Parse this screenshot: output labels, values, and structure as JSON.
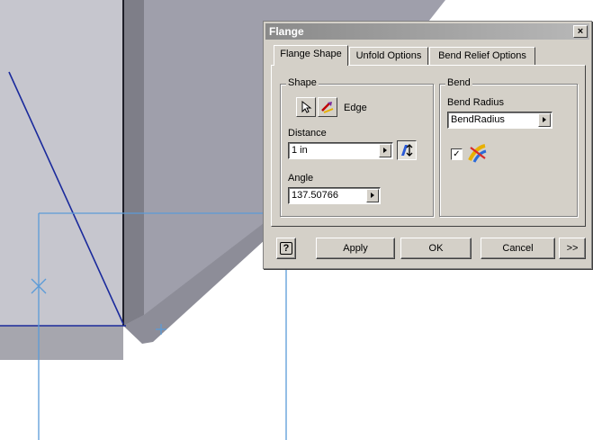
{
  "dialog": {
    "title": "Flange",
    "close_label": "×",
    "tabs": [
      {
        "label": "Flange Shape"
      },
      {
        "label": "Unfold Options"
      },
      {
        "label": "Bend Relief Options"
      }
    ],
    "shape": {
      "group_label": "Shape",
      "edge_label": "Edge",
      "distance_label": "Distance",
      "distance_value": "1 in",
      "angle_label": "Angle",
      "angle_value": "137.50766"
    },
    "bend": {
      "group_label": "Bend",
      "radius_label": "Bend Radius",
      "radius_value": "BendRadius",
      "checkbox_mark": "✓",
      "checked": true
    },
    "buttons": {
      "help": "?",
      "apply": "Apply",
      "ok": "OK",
      "cancel": "Cancel",
      "more": ">>"
    }
  },
  "colors": {
    "part_light": "#c6c6ce",
    "part_face": "#a9a9b3",
    "part_dark": "#8b8b94",
    "sketch_blue": "#1a2a9c",
    "preview_blue": "#5b9bd8",
    "dialog_bg": "#d4d0c8"
  }
}
